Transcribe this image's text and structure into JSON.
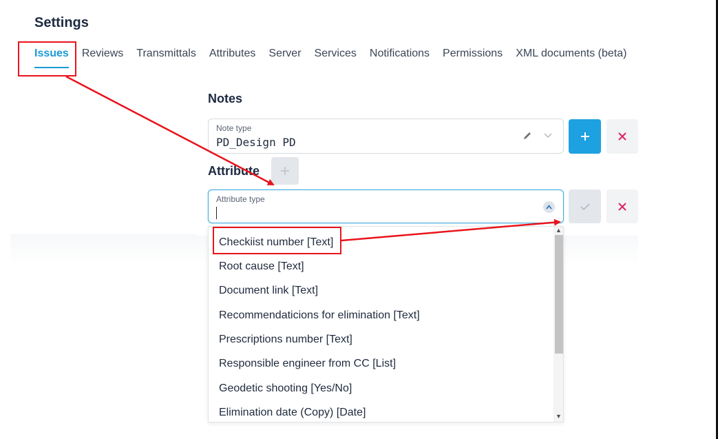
{
  "page": {
    "title": "Settings"
  },
  "tabs": [
    {
      "label": "Issues",
      "active": true
    },
    {
      "label": "Reviews"
    },
    {
      "label": "Transmittals"
    },
    {
      "label": "Attributes"
    },
    {
      "label": "Server"
    },
    {
      "label": "Services"
    },
    {
      "label": "Notifications"
    },
    {
      "label": "Permissions"
    },
    {
      "label": "XML documents (beta)"
    }
  ],
  "notes": {
    "title": "Notes",
    "note_type_label": "Note type",
    "note_type_value": "PD_Design PD",
    "add_icon": "plus-icon",
    "remove_icon": "close-icon"
  },
  "attribute": {
    "title": "Attribute",
    "attribute_type_label": "Attribute type",
    "attribute_type_value": "",
    "confirm_icon": "check-icon",
    "remove_icon": "close-icon"
  },
  "dropdown": {
    "options": [
      "Checkiist number [Text]",
      "Root cause [Text]",
      "Document link [Text]",
      "Recommendaticions for elimination [Text]",
      "Prescriptions number [Text]",
      "Responsible engineer from CC [List]",
      "Geodetic shooting [Yes/No]",
      "Elimination date (Copy) [Date]"
    ]
  },
  "colors": {
    "accent": "#1da1e0",
    "annotation": "#e8141c",
    "danger": "#e0245e"
  }
}
